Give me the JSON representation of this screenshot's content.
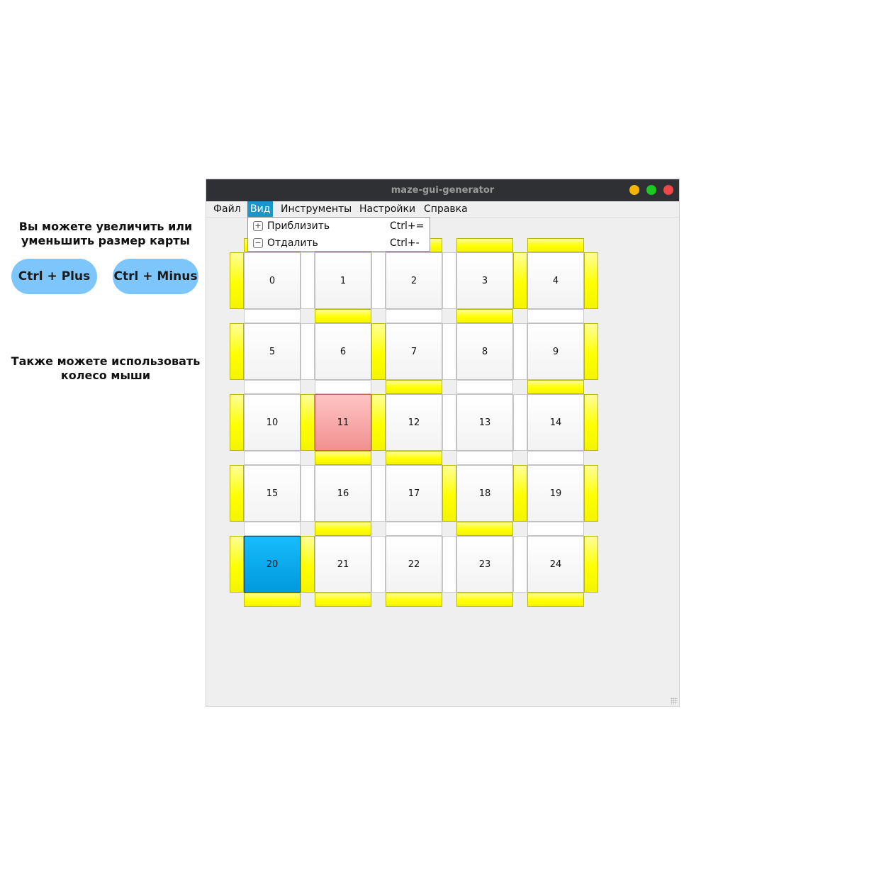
{
  "promo": {
    "zoom_text": "Вы можете увеличить или уменьшить размер карты",
    "plus_label": "Ctrl + Plus",
    "minus_label": "Ctrl + Minus",
    "wheel_text": "Также можете использовать колесо мыши"
  },
  "window": {
    "title": "maze-gui-generator",
    "buttons": {
      "minimize_color": "#f5b400",
      "maximize_color": "#1ec820",
      "close_color": "#f04848"
    }
  },
  "menu": {
    "items": [
      "Файл",
      "Вид",
      "Инструменты",
      "Настройки",
      "Справка"
    ],
    "active_index": 1,
    "active_color": "#1c94cc"
  },
  "dropdown": {
    "items": [
      {
        "label": "Приблизить",
        "shortcut": "Ctrl+=",
        "icon": "zoom-in-icon"
      },
      {
        "label": "Отдалить",
        "shortcut": "Ctrl+-",
        "icon": "zoom-out-icon"
      }
    ]
  },
  "maze": {
    "rows": 5,
    "cols": 5,
    "cells": [
      "0",
      "1",
      "2",
      "3",
      "4",
      "5",
      "6",
      "7",
      "8",
      "9",
      "10",
      "11",
      "12",
      "13",
      "14",
      "15",
      "16",
      "17",
      "18",
      "19",
      "20",
      "21",
      "22",
      "23",
      "24"
    ],
    "start_cell": "11",
    "finish_cell": "20",
    "colors": {
      "wall": "#ffff00",
      "start": "#f4a0a0",
      "finish": "#0aaef0"
    },
    "horizontal_walls": [
      [
        1,
        1,
        1,
        1,
        1
      ],
      [
        0,
        1,
        0,
        1,
        0
      ],
      [
        0,
        0,
        1,
        0,
        1
      ],
      [
        0,
        1,
        1,
        0,
        0
      ],
      [
        0,
        1,
        0,
        1,
        0
      ],
      [
        1,
        1,
        1,
        1,
        1
      ]
    ],
    "vertical_walls": [
      [
        1,
        0,
        0,
        0,
        1,
        1
      ],
      [
        1,
        0,
        1,
        0,
        0,
        1
      ],
      [
        1,
        1,
        1,
        0,
        0,
        1
      ],
      [
        1,
        0,
        0,
        1,
        1,
        1
      ],
      [
        1,
        1,
        0,
        0,
        0,
        1
      ]
    ]
  }
}
